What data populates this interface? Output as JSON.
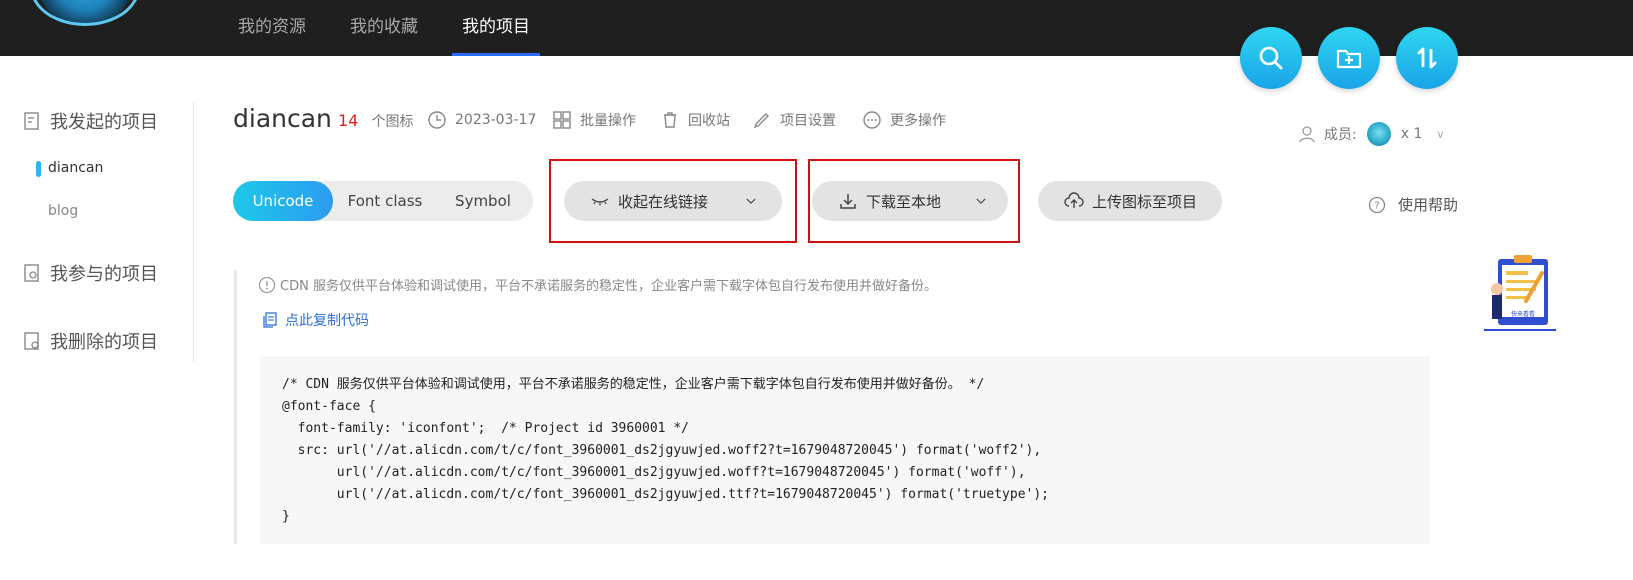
{
  "nav": {
    "tabs": [
      {
        "label": "我的资源"
      },
      {
        "label": "我的收藏"
      },
      {
        "label": "我的项目"
      }
    ]
  },
  "fab": {
    "icons": [
      "search-icon",
      "add-folder-icon",
      "sort-icon"
    ]
  },
  "sidebar": {
    "initiated": "我发起的项目",
    "projects": [
      {
        "label": "diancan"
      },
      {
        "label": "blog"
      }
    ],
    "joined": "我参与的项目",
    "deleted": "我删除的项目"
  },
  "project": {
    "name": "diancan",
    "icon_count": "14",
    "icon_unit": "个图标",
    "date": "2023-03-17",
    "batch": "批量操作",
    "recycle": "回收站",
    "settings": "项目设置",
    "more": "更多操作",
    "members_label": "成员:",
    "members_count": "x 1"
  },
  "toolbar": {
    "tabs": [
      {
        "label": "Unicode"
      },
      {
        "label": "Font class"
      },
      {
        "label": "Symbol"
      }
    ],
    "collapse_link": "收起在线链接",
    "download": "下载至本地",
    "upload": "上传图标至项目",
    "help": "使用帮助"
  },
  "content": {
    "notice": "CDN 服务仅供平台体验和调试使用，平台不承诺服务的稳定性，企业客户需下载字体包自行发布使用并做好备份。",
    "copy_link": "点此复制代码",
    "code": "/* CDN 服务仅供平台体验和调试使用，平台不承诺服务的稳定性，企业客户需下载字体包自行发布使用并做好备份。 */\n@font-face {\n  font-family: 'iconfont';  /* Project id 3960001 */\n  src: url('//at.alicdn.com/t/c/font_3960001_ds2jgyuwjed.woff2?t=1679048720045') format('woff2'),\n       url('//at.alicdn.com/t/c/font_3960001_ds2jgyuwjed.woff?t=1679048720045') format('woff'),\n       url('//at.alicdn.com/t/c/font_3960001_ds2jgyuwjed.ttf?t=1679048720045') format('truetype');\n}"
  },
  "illustration": {
    "caption": "快来看看"
  },
  "colors": {
    "accent": "#2ab5f0",
    "highlight_box": "#cc1111",
    "count": "#e02020",
    "link": "#2f6fd8"
  }
}
